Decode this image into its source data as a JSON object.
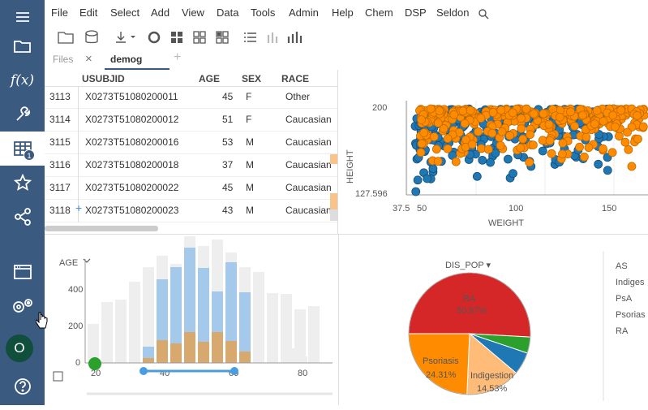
{
  "menu": [
    "File",
    "Edit",
    "Select",
    "Add",
    "View",
    "Data",
    "Tools",
    "Admin",
    "Help",
    "Chem",
    "DSP",
    "Seldon"
  ],
  "sidebar": {
    "badge": "1",
    "avatar": "O",
    "items": [
      "menu-icon",
      "folder-icon",
      "function-icon",
      "wrench-icon",
      "table-icon",
      "star-icon",
      "share-icon",
      "window-icon",
      "settings-icon",
      "help-icon"
    ]
  },
  "tabs": {
    "files": "Files",
    "close": "×",
    "active": "demog",
    "add": "+"
  },
  "grid": {
    "columns": [
      "",
      "USUBJID",
      "AGE",
      "SEX",
      "RACE"
    ],
    "rows": [
      {
        "n": "3113",
        "id": "X0273T51080200011",
        "age": "45",
        "sex": "F",
        "race": "Other"
      },
      {
        "n": "3114",
        "id": "X0273T51080200012",
        "age": "51",
        "sex": "F",
        "race": "Caucasian"
      },
      {
        "n": "3115",
        "id": "X0273T51080200016",
        "age": "53",
        "sex": "M",
        "race": "Caucasian"
      },
      {
        "n": "3116",
        "id": "X0273T51080200018",
        "age": "37",
        "sex": "M",
        "race": "Caucasian"
      },
      {
        "n": "3117",
        "id": "X0273T51080200022",
        "age": "45",
        "sex": "M",
        "race": "Caucasian"
      },
      {
        "n": "3118",
        "id": "X0273T51080200023",
        "age": "43",
        "sex": "M",
        "race": "Caucasian"
      }
    ]
  },
  "scatter": {
    "xlabel": "WEIGHT",
    "ylabel": "HEIGHT",
    "xticks": [
      "37.5",
      "50",
      "100",
      "150"
    ],
    "yticks": [
      "200",
      "127.596"
    ],
    "colors": {
      "blue": "#1f77b4",
      "orange": "#ff8c00"
    }
  },
  "histogram": {
    "column": "AGE",
    "yticks": [
      "0",
      "200",
      "400"
    ],
    "xticks": [
      "20",
      "40",
      "60",
      "80"
    ],
    "colors": {
      "all": "#eeeeee",
      "selected": "#a5c9eb",
      "filtered": "#d7a96e"
    }
  },
  "pie": {
    "column": "DIS_POP",
    "slices": [
      {
        "label": "RA",
        "pct": "50.87%",
        "color": "#d62728"
      },
      {
        "label": "Psoriasis",
        "pct": "24.31%",
        "color": "#ff8c00"
      },
      {
        "label": "Indigestion",
        "pct": "14.53%",
        "color": "#ffbb78"
      },
      {
        "label": "AS",
        "pct": "",
        "color": "#1f77b4"
      },
      {
        "label": "PsA",
        "pct": "",
        "color": "#2ca02c"
      }
    ],
    "legend": [
      {
        "label": "AS",
        "color": "#1f77b4"
      },
      {
        "label": "Indiges",
        "color": "#ff8c00"
      },
      {
        "label": "PsA",
        "color": "#2ca02c"
      },
      {
        "label": "Psorias",
        "color": "#7f7f7f"
      },
      {
        "label": "RA",
        "color": "#d62728"
      }
    ]
  }
}
